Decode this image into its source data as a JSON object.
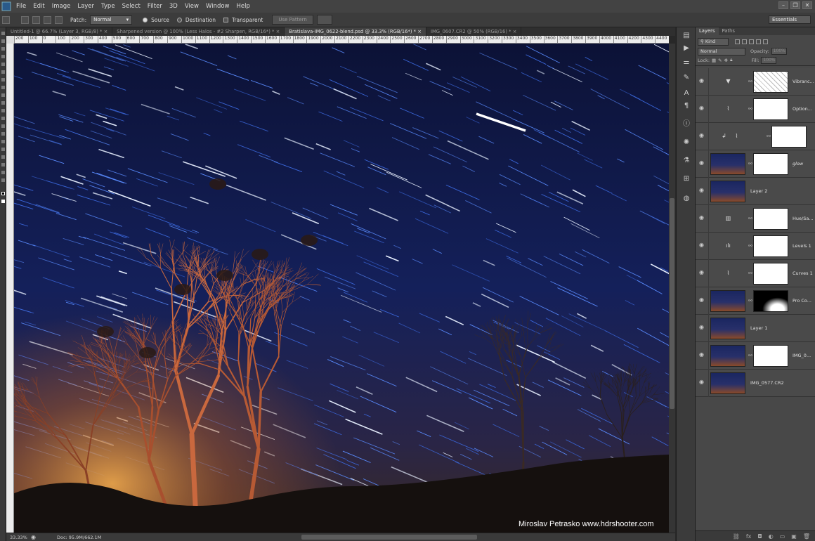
{
  "menu": [
    "File",
    "Edit",
    "Image",
    "Layer",
    "Type",
    "Select",
    "Filter",
    "3D",
    "View",
    "Window",
    "Help"
  ],
  "window_buttons": [
    "–",
    "❐",
    "✕"
  ],
  "options": {
    "patch_label": "Patch:",
    "patch_mode": "Normal",
    "source_label": "Source",
    "destination_label": "Destination",
    "transparent_label": "Transparent",
    "use_pattern_label": "Use Pattern",
    "workspace": "Essentials"
  },
  "tabs": [
    {
      "label": "Untitled-1 @ 66.7% (Layer 3, RGB/8) *",
      "active": false
    },
    {
      "label": "Sharpened version @ 100% (Less Halos - #2 Sharpen, RGB/16*) *",
      "active": false
    },
    {
      "label": "Bratislava-IMG_0622-blend.psd @ 33.3% (RGB/16*) *",
      "active": true
    },
    {
      "label": "IMG_0607.CR2 @ 50% (RGB/16) *",
      "active": false
    }
  ],
  "ruler_ticks": [
    "200",
    "100",
    "0",
    "100",
    "200",
    "300",
    "400",
    "500",
    "600",
    "700",
    "800",
    "900",
    "1000",
    "1100",
    "1200",
    "1300",
    "1400",
    "1500",
    "1600",
    "1700",
    "1800",
    "1900",
    "2000",
    "2100",
    "2200",
    "2300",
    "2400",
    "2500",
    "2600",
    "2700",
    "2800",
    "2900",
    "3000",
    "3100",
    "3200",
    "3300",
    "3400",
    "3500",
    "3600",
    "3700",
    "3800",
    "3900",
    "4000",
    "4100",
    "4200",
    "4300",
    "4400"
  ],
  "status": {
    "zoom": "33.33%",
    "doc": "Doc: 95.9M/662.1M"
  },
  "watermark": "Miroslav  Petrasko  www.hdrshooter.com",
  "layers_panel": {
    "tabs": [
      "Layers",
      "Paths"
    ],
    "kind": "Kind",
    "blend_mode": "Normal",
    "opacity_label": "Opacity:",
    "opacity_value": "100%",
    "lock_label": "Lock:",
    "fill_label": "Fill:",
    "fill_value": "100%",
    "layers": [
      {
        "name": "Vibranc...",
        "kind": "adjustment",
        "icon": "vibrance-icon",
        "mask": "noise"
      },
      {
        "name": "Option...",
        "kind": "adjustment",
        "icon": "curves-icon",
        "mask": "white"
      },
      {
        "name": "",
        "kind": "clipped-adjustment",
        "icon": "curves-icon",
        "mask": "white"
      },
      {
        "name": "glow",
        "kind": "image-mask",
        "mask": "white"
      },
      {
        "name": "Layer 2",
        "kind": "image"
      },
      {
        "name": "Hue/Sa...",
        "kind": "adjustment",
        "icon": "hue-saturation-icon",
        "mask": "white"
      },
      {
        "name": "Levels 1",
        "kind": "adjustment",
        "icon": "levels-icon",
        "mask": "white"
      },
      {
        "name": "Curves 1",
        "kind": "adjustment",
        "icon": "curves-icon",
        "mask": "white"
      },
      {
        "name": "Pro Co...",
        "kind": "image-mask",
        "mask": "black"
      },
      {
        "name": "Layer 1",
        "kind": "image"
      },
      {
        "name": "IMG_0...",
        "kind": "image-mask",
        "mask": "white"
      },
      {
        "name": "IMG_0577.CR2",
        "kind": "image"
      }
    ]
  }
}
